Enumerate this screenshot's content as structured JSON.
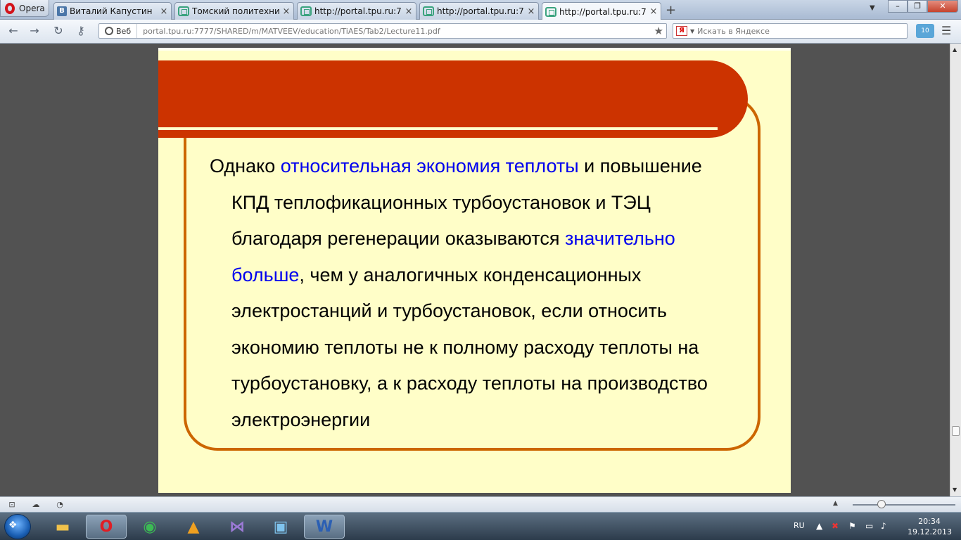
{
  "browser": {
    "menu_label": "Opera",
    "tabs": [
      {
        "title": "Виталий Капустин",
        "icon": "vk-icon"
      },
      {
        "title": "Томский политехниче...",
        "icon": "tpu-icon"
      },
      {
        "title": "http://portal.tpu.ru:777...",
        "icon": "tpu-icon"
      },
      {
        "title": "http://portal.tpu.ru:777...",
        "icon": "tpu-icon"
      },
      {
        "title": "http://portal.tpu.ru:777...",
        "icon": "tpu-icon",
        "active": true
      }
    ],
    "tab_close_glyph": "×",
    "new_tab_glyph": "+",
    "address": {
      "web_label": "Веб",
      "url": "portal.tpu.ru:7777/SHARED/m/MATVEEV/education/TiAES/Tab2/Lecture11.pdf"
    },
    "search": {
      "engine_logo": "Я",
      "placeholder": "Искать в Яндексе"
    },
    "extension_badge": "10"
  },
  "slide": {
    "colors": {
      "band": "#cc3300",
      "frame": "#cc6600",
      "background": "#fffec8",
      "highlight": "#0000ee"
    },
    "segments": [
      {
        "text": "Однако ",
        "highlight": false
      },
      {
        "text": "относительная экономия теплоты",
        "highlight": true
      },
      {
        "text": " и повышение КПД теплофикационных турбоустановок и ТЭЦ благодаря регенерации оказываются ",
        "highlight": false
      },
      {
        "text": "значительно больше",
        "highlight": true
      },
      {
        "text": ", чем у аналогичных конденсационных электростанций и турбоустановок, если относить экономию теплоты не к полному расходу теплоты на турбоустановку, а к расходу теплоты на производство электроэнергии",
        "highlight": false
      }
    ]
  },
  "taskbar": {
    "language": "RU",
    "time": "20:34",
    "date": "19.12.2013",
    "apps": [
      "explorer",
      "opera",
      "chrome",
      "aimp",
      "visual-studio",
      "photo-viewer",
      "word"
    ]
  }
}
